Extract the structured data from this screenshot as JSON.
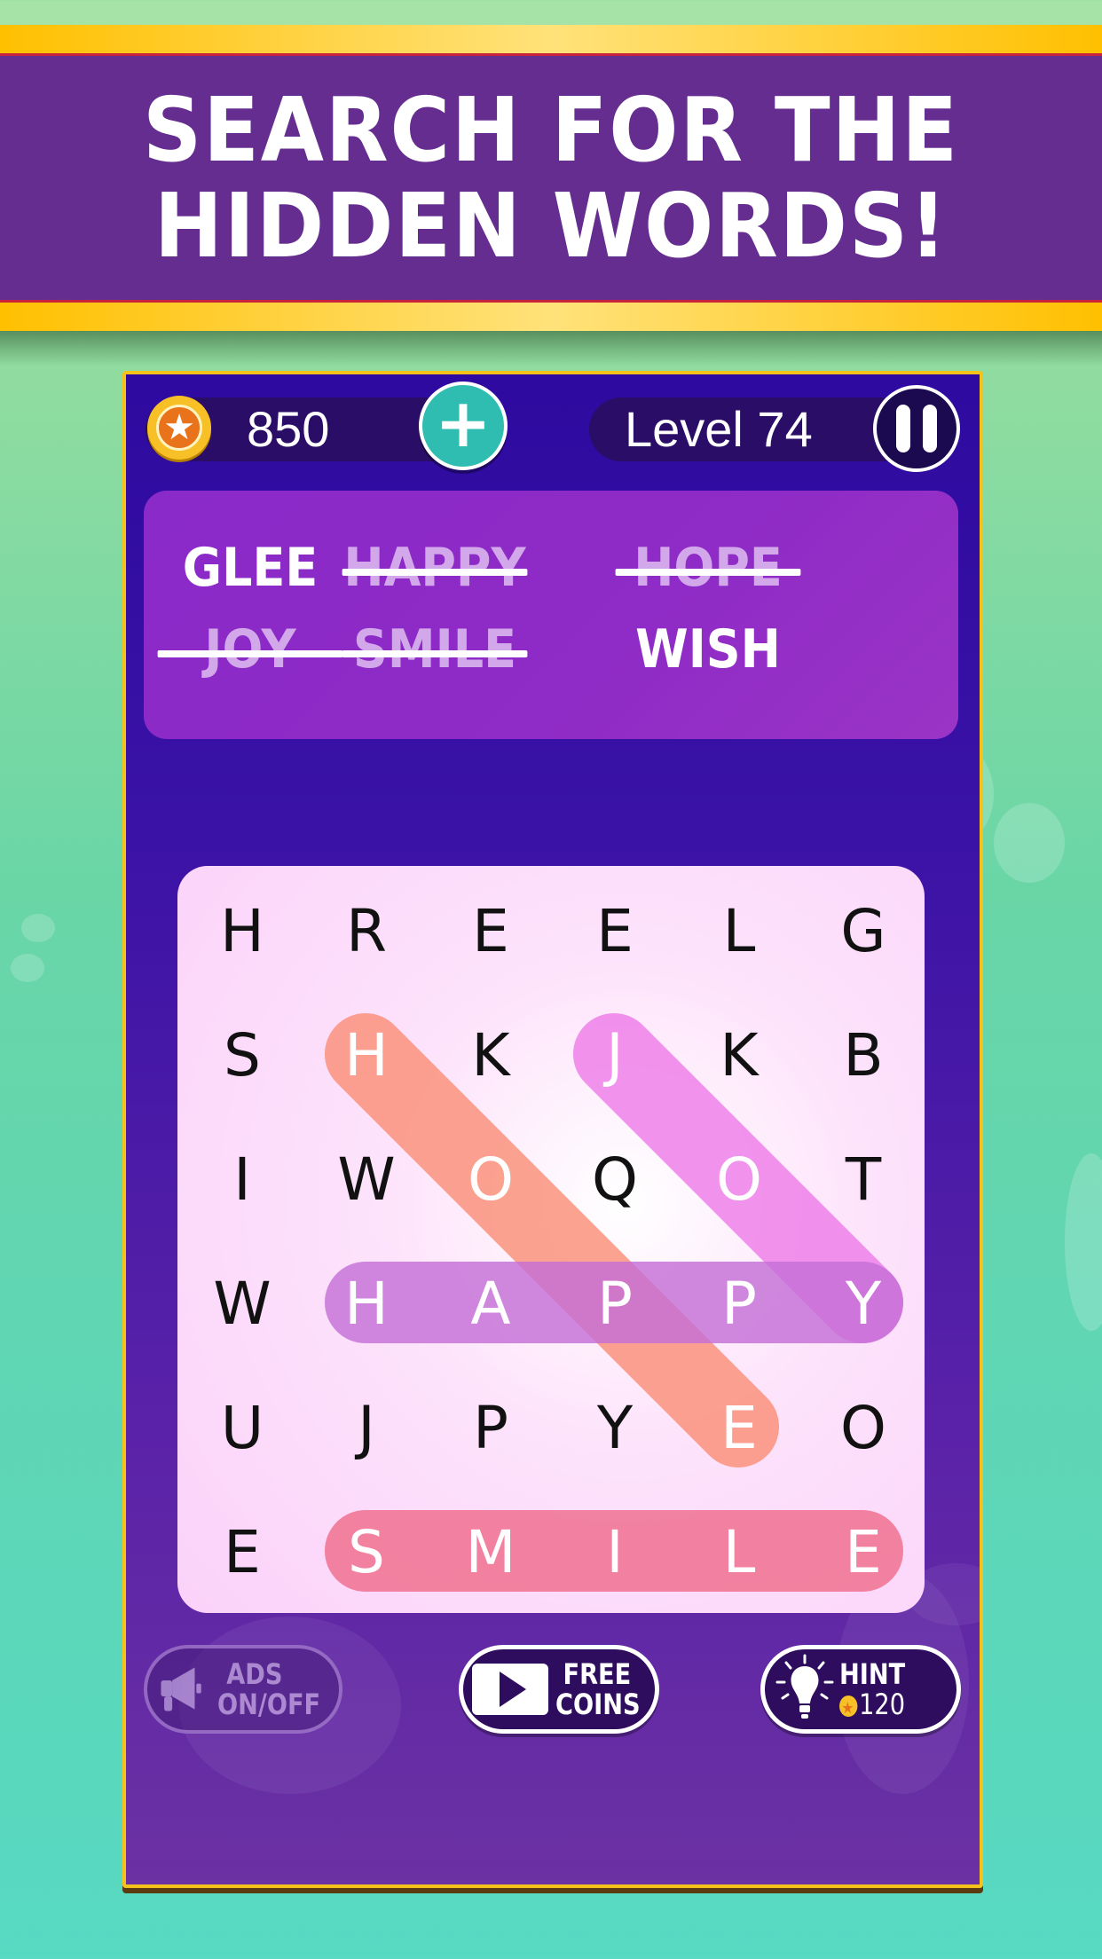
{
  "banner": {
    "line1": "SEARCH FOR THE",
    "line2": "HIDDEN WORDS!"
  },
  "header": {
    "coins": "850",
    "coin_icon": "star-coin-icon",
    "add_coins_icon": "plus-icon",
    "level_label": "Level 74",
    "pause_icon": "pause-icon"
  },
  "words": [
    {
      "text": "GLEE",
      "found": false
    },
    {
      "text": "HAPPY",
      "found": true
    },
    {
      "text": "HOPE",
      "found": true
    },
    {
      "text": "JOY",
      "found": true
    },
    {
      "text": "SMILE",
      "found": true
    },
    {
      "text": "WISH",
      "found": false
    }
  ],
  "grid": {
    "rows": [
      [
        "H",
        "R",
        "E",
        "E",
        "L",
        "G"
      ],
      [
        "S",
        "H",
        "K",
        "J",
        "K",
        "B"
      ],
      [
        "I",
        "W",
        "O",
        "Q",
        "O",
        "T"
      ],
      [
        "W",
        "H",
        "A",
        "P",
        "P",
        "Y"
      ],
      [
        "U",
        "J",
        "P",
        "Y",
        "E",
        "O"
      ],
      [
        "E",
        "S",
        "M",
        "I",
        "L",
        "E"
      ]
    ],
    "highlights": [
      {
        "word": "HOPE",
        "start": [
          1,
          1
        ],
        "end": [
          4,
          4
        ],
        "color": "#fa8f78"
      },
      {
        "word": "JOY",
        "start": [
          1,
          3
        ],
        "end": [
          3,
          5
        ],
        "color": "#ee7de8"
      },
      {
        "word": "HAPPY",
        "start": [
          3,
          1
        ],
        "end": [
          3,
          5
        ],
        "color": "#c46fd6"
      },
      {
        "word": "SMILE",
        "start": [
          5,
          1
        ],
        "end": [
          5,
          5
        ],
        "color": "#ef6d8c"
      }
    ]
  },
  "buttons": {
    "ads": {
      "line1": "ADS",
      "line2": "ON/OFF",
      "icon": "megaphone-icon"
    },
    "free_coins": {
      "line1": "FREE",
      "line2": "COINS",
      "icon": "play-video-icon"
    },
    "hint": {
      "line1": "HINT",
      "cost": "120",
      "icon": "lightbulb-icon"
    }
  },
  "colors": {
    "banner": "#662d91",
    "gold": "#ffc000",
    "frame_bg": "#3a12a6",
    "word_panel": "#8a2ac8",
    "plus_button": "#2ebdb0",
    "background": "#5fd6b4"
  }
}
